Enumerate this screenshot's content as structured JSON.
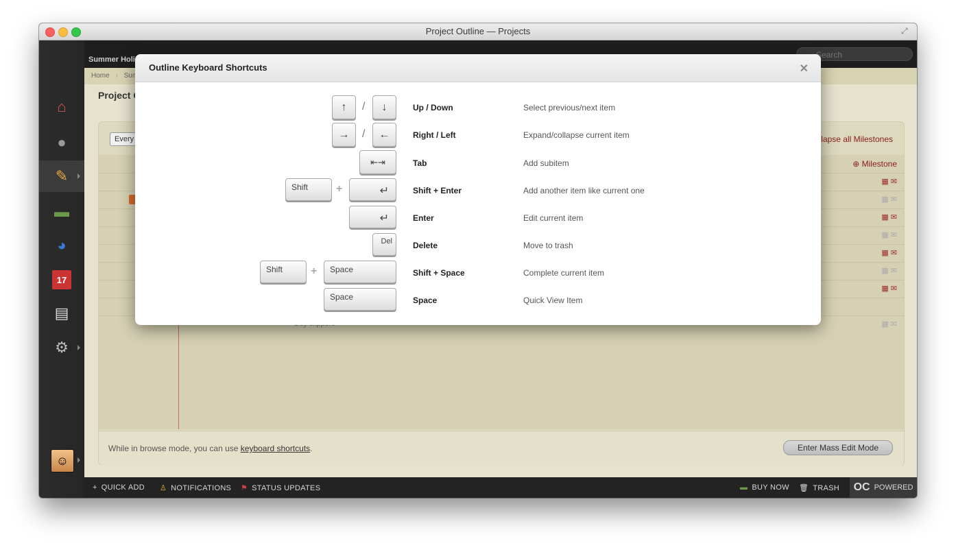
{
  "window": {
    "title": "Project Outline — Projects"
  },
  "topbar": {
    "project_name": "Summer Holi",
    "search_placeholder": "Search"
  },
  "breadcrumb": {
    "home": "Home",
    "current": "Sum"
  },
  "page": {
    "title": "Project O"
  },
  "panel": {
    "filter_label": "Every",
    "collapse_link": "lapse all Milestones",
    "milestone_link": "Milestone",
    "task_text": "Buy slippers",
    "footer_text": "While in browse mode, you can use ",
    "footer_link": "keyboard shortcuts",
    "footer_period": ".",
    "mass_edit_button": "Enter Mass Edit Mode"
  },
  "sidebar": {
    "items": [
      {
        "name": "home-icon",
        "glyph": "🏠"
      },
      {
        "name": "people-icon",
        "glyph": "👤"
      },
      {
        "name": "projects-icon",
        "glyph": "✏️"
      },
      {
        "name": "money-icon",
        "glyph": "💵"
      },
      {
        "name": "reports-icon",
        "glyph": "◕"
      },
      {
        "name": "calendar-icon",
        "glyph": "17"
      },
      {
        "name": "documents-icon",
        "glyph": "📄"
      },
      {
        "name": "settings-icon",
        "glyph": "⚙"
      }
    ]
  },
  "bottombar": {
    "quick_add": "QUICK ADD",
    "notifications": "NOTIFICATIONS",
    "status_updates": "STATUS UPDATES",
    "buy_now": "BUY NOW",
    "trash": "TRASH",
    "powered": "POWERED"
  },
  "modal": {
    "title": "Outline Keyboard Shortcuts",
    "close": "✕",
    "shortcuts": [
      {
        "name": "Up / Down",
        "desc": "Select previous/next item"
      },
      {
        "name": "Right / Left",
        "desc": "Expand/collapse current item"
      },
      {
        "name": "Tab",
        "desc": "Add subitem"
      },
      {
        "name": "Shift + Enter",
        "desc": "Add another item like current one"
      },
      {
        "name": "Enter",
        "desc": "Edit current item"
      },
      {
        "name": "Delete",
        "desc": "Move to trash"
      },
      {
        "name": "Shift + Space",
        "desc": "Complete current item"
      },
      {
        "name": "Space",
        "desc": "Quick View Item"
      }
    ],
    "keys": {
      "up": "↑",
      "down": "↓",
      "right": "→",
      "left": "←",
      "tab": "⇤⇥",
      "enter": "↵",
      "shift": "Shift",
      "del": "Del",
      "space": "Space",
      "slash": "/",
      "plus": "+"
    }
  }
}
